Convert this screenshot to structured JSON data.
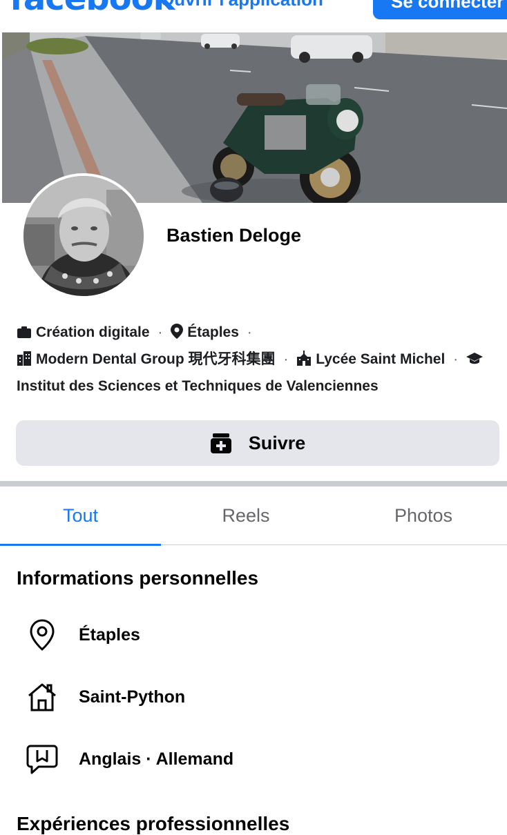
{
  "topbar": {
    "logo": "facebook",
    "open_app": "Ouvrir l'application",
    "login": "Se connecter"
  },
  "profile": {
    "name": "Bastien Deloge"
  },
  "intro": [
    {
      "icon": "briefcase-icon",
      "label": "Création digitale"
    },
    {
      "icon": "location-pin-icon",
      "label": "Étaples"
    },
    {
      "icon": "building-icon",
      "label": "Modern Dental Group 現代牙科集團"
    },
    {
      "icon": "school-icon",
      "label": "Lycée Saint Michel"
    },
    {
      "icon": "graduation-cap-icon",
      "label": "Institut des Sciences et Techniques de Valenciennes"
    }
  ],
  "follow": {
    "label": "Suivre",
    "icon": "follow-add-icon"
  },
  "tabs": [
    {
      "label": "Tout",
      "active": true
    },
    {
      "label": "Reels",
      "active": false
    },
    {
      "label": "Photos",
      "active": false
    }
  ],
  "personal_info": {
    "title": "Informations personnelles",
    "items": [
      {
        "icon": "location-pin-icon",
        "label": "Étaples"
      },
      {
        "icon": "home-icon",
        "label": "Saint-Python"
      },
      {
        "icon": "speech-bubble-icon",
        "label": "Anglais · Allemand"
      }
    ]
  },
  "work": {
    "title": "Expériences professionnelles"
  },
  "colors": {
    "brand": "#1877f2",
    "button_bg": "#e4e6eb",
    "text": "#050505",
    "muted": "#65676b"
  }
}
